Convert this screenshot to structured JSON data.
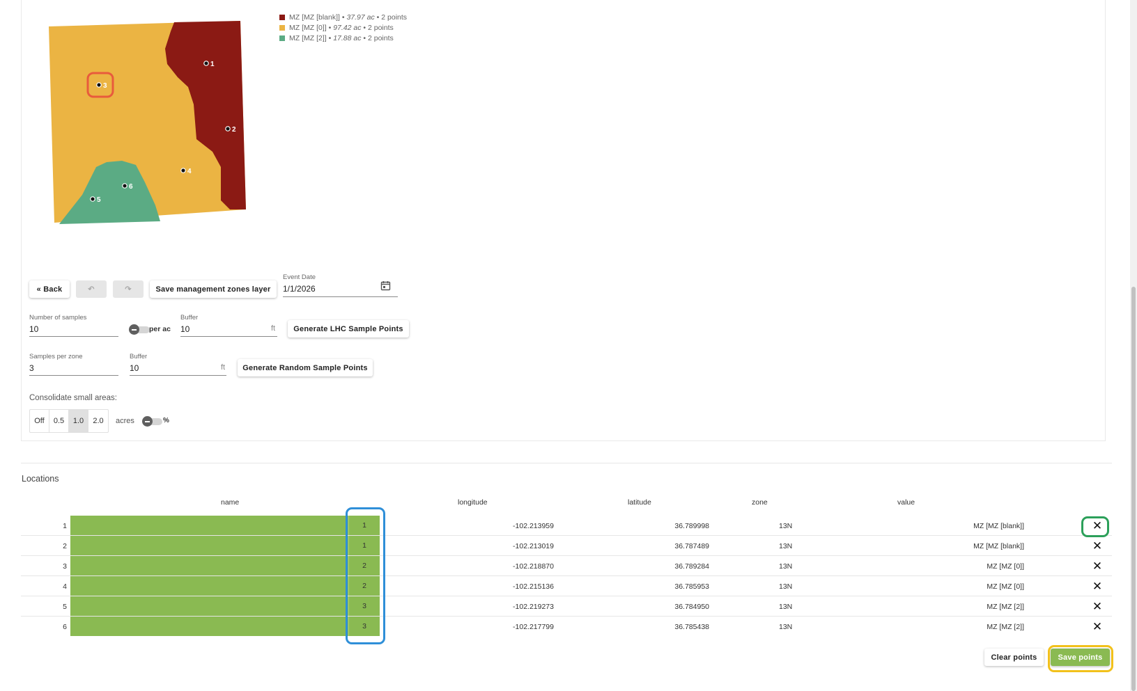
{
  "map": {
    "legend": [
      {
        "zone": "MZ [MZ [blank]]",
        "area": "37.97 ac",
        "points": "2 points",
        "color": "#8b1a14"
      },
      {
        "zone": "MZ [MZ [0]]",
        "area": "97.42 ac",
        "points": "2 points",
        "color": "#ebb443"
      },
      {
        "zone": "MZ [MZ [2]]",
        "area": "17.88 ac",
        "points": "2 points",
        "color": "#5bab84"
      }
    ],
    "points": [
      "1",
      "2",
      "3",
      "4",
      "5",
      "6"
    ]
  },
  "toolbar": {
    "back_label": "« Back",
    "undo_label": "↶",
    "redo_label": "↷",
    "save_zones_label": "Save management zones layer",
    "event_date_label": "Event Date",
    "event_date_value": "1/1/2026"
  },
  "lhc": {
    "num_samples_label": "Number of samples",
    "num_samples_value": "10",
    "per_ac_label": "per ac",
    "buffer_label": "Buffer",
    "buffer_value": "10",
    "buffer_unit": "ft",
    "generate_label": "Generate LHC Sample Points"
  },
  "random": {
    "per_zone_label": "Samples per zone",
    "per_zone_value": "3",
    "buffer_label": "Buffer",
    "buffer_value": "10",
    "buffer_unit": "ft",
    "generate_label": "Generate Random Sample Points"
  },
  "consolidate": {
    "label": "Consolidate small areas:",
    "options": [
      "Off",
      "0.5",
      "1.0",
      "2.0"
    ],
    "selected": "1.0",
    "acres_label": "acres",
    "percent_label": "%"
  },
  "locations": {
    "title": "Locations",
    "columns": [
      "name",
      "longitude",
      "latitude",
      "zone",
      "value"
    ],
    "rows": [
      {
        "index": "1",
        "zone_id": "1",
        "longitude": "-102.213959",
        "latitude": "36.789998",
        "zone": "13N",
        "value": "MZ [MZ [blank]]"
      },
      {
        "index": "2",
        "zone_id": "1",
        "longitude": "-102.213019",
        "latitude": "36.787489",
        "zone": "13N",
        "value": "MZ [MZ [blank]]"
      },
      {
        "index": "3",
        "zone_id": "2",
        "longitude": "-102.218870",
        "latitude": "36.789284",
        "zone": "13N",
        "value": "MZ [MZ [0]]"
      },
      {
        "index": "4",
        "zone_id": "2",
        "longitude": "-102.215136",
        "latitude": "36.785953",
        "zone": "13N",
        "value": "MZ [MZ [0]]"
      },
      {
        "index": "5",
        "zone_id": "3",
        "longitude": "-102.219273",
        "latitude": "36.784950",
        "zone": "13N",
        "value": "MZ [MZ [2]]"
      },
      {
        "index": "6",
        "zone_id": "3",
        "longitude": "-102.217799",
        "latitude": "36.785438",
        "zone": "13N",
        "value": "MZ [MZ [2]]"
      }
    ],
    "delete_icon": "close-icon"
  },
  "actions": {
    "clear_label": "Clear points",
    "save_label": "Save points"
  },
  "colors": {
    "name_cell": "#8aba52",
    "save_button": "#8aba52",
    "highlight_orange": "#e85b3c",
    "highlight_blue": "#2f8fd8",
    "highlight_green": "#2ca05a",
    "highlight_yellow": "#f2c11b"
  }
}
